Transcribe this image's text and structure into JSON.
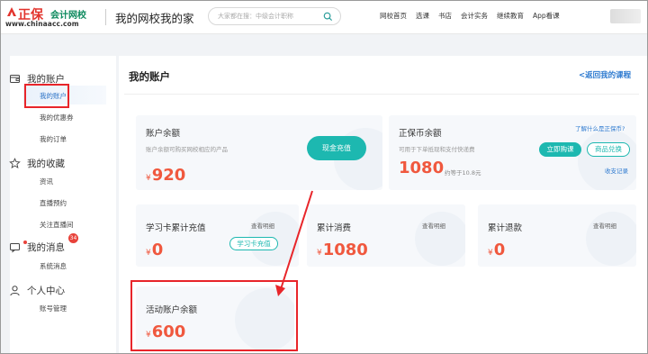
{
  "header": {
    "logo": {
      "name1": "正保",
      "name2": "会计网校",
      "url": "www.chinaacc.com"
    },
    "site_title": "我的网校我的家",
    "search": {
      "placeholder": "大家都在搜：中级会计职称"
    },
    "nav": [
      "网校首页",
      "选课",
      "书店",
      "会计实务",
      "继续教育",
      "App看课"
    ]
  },
  "sidebar": {
    "groups": [
      {
        "title": "我的账户",
        "icon": "wallet-icon",
        "items": [
          "我的账户",
          "我的优惠券",
          "我的订单"
        ]
      },
      {
        "title": "我的收藏",
        "icon": "star-icon",
        "items": [
          "资讯",
          "直播预约",
          "关注直播间"
        ]
      },
      {
        "title": "我的消息",
        "icon": "message-icon",
        "badge": "34",
        "items": [
          "系统消息"
        ]
      },
      {
        "title": "个人中心",
        "icon": "user-icon",
        "items": [
          "账号管理"
        ]
      }
    ],
    "active_item": "我的账户"
  },
  "main": {
    "title": "我的账户",
    "back_link": "<返回我的课程",
    "cards": {
      "balance": {
        "title": "账户余额",
        "desc": "账户余额可购买网校相应的产品",
        "currency": "¥",
        "amount": "920",
        "button": "现金充值"
      },
      "zhengbao_coin": {
        "title": "正保币余额",
        "desc": "可用于下单抵现和支付快递费",
        "amount": "1080",
        "approx": "约等于10.8元",
        "help_link": "了解什么是正保币?",
        "buy_button": "立即购课",
        "exchange_button": "商品兑换",
        "records_link": "收支记录"
      },
      "study_card": {
        "title": "学习卡累计充值",
        "link": "查看明细",
        "button": "学习卡充值",
        "currency": "¥",
        "amount": "0"
      },
      "total_spent": {
        "title": "累计消费",
        "link": "查看明细",
        "currency": "¥",
        "amount": "1080"
      },
      "total_refund": {
        "title": "累计退款",
        "link": "查看明细",
        "currency": "¥",
        "amount": "0"
      },
      "activity_balance": {
        "title": "活动账户余额",
        "currency": "¥",
        "amount": "600"
      }
    }
  },
  "colors": {
    "accent_teal": "#1db8b0",
    "amount_orange": "#f0583e",
    "annotation_red": "#e8252a",
    "link_blue": "#2f7bd0"
  }
}
